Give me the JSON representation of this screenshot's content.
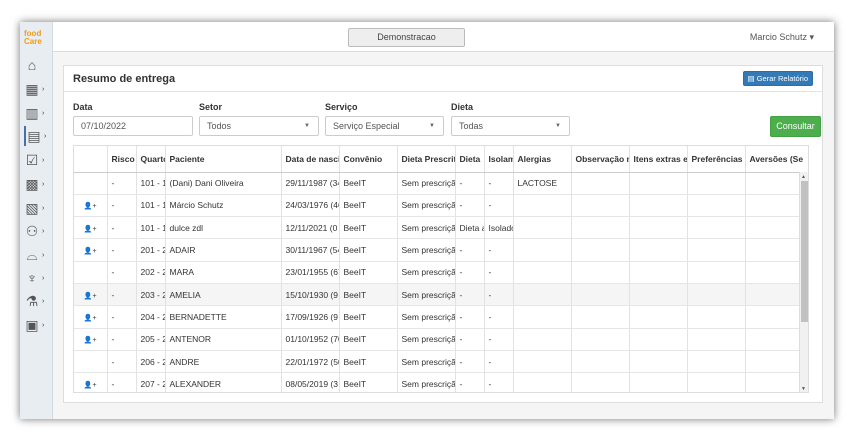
{
  "app": {
    "logo_line1": "food",
    "logo_line2": "Care"
  },
  "sidebar": {
    "items": [
      {
        "icon": "home-icon",
        "glyph": "⌂"
      },
      {
        "icon": "grid-icon",
        "glyph": "▦"
      },
      {
        "icon": "building-icon",
        "glyph": "▥"
      },
      {
        "icon": "form-icon",
        "glyph": "▤"
      },
      {
        "icon": "checklist-icon",
        "glyph": "☑"
      },
      {
        "icon": "report-building-icon",
        "glyph": "▩"
      },
      {
        "icon": "document-icon",
        "glyph": "▧"
      },
      {
        "icon": "people-icon",
        "glyph": "⚇"
      },
      {
        "icon": "food-tray-icon",
        "glyph": "⌓"
      },
      {
        "icon": "dietitian-icon",
        "glyph": "♆"
      },
      {
        "icon": "flask-icon",
        "glyph": "⚗"
      },
      {
        "icon": "settings-panel-icon",
        "glyph": "▣"
      }
    ]
  },
  "topbar": {
    "center_button": "Demonstracao",
    "user_name": "Marcio Schutz"
  },
  "panel": {
    "title": "Resumo de entrega",
    "report_button": "Gerar Relatório",
    "filters": {
      "data_label": "Data",
      "data_value": "07/10/2022",
      "setor_label": "Setor",
      "setor_value": "Todos",
      "servico_label": "Serviço",
      "servico_value": "Serviço Especial",
      "dieta_label": "Dieta",
      "dieta_value": "Todas"
    },
    "consult_button": "Consultar"
  },
  "table": {
    "headers": [
      "",
      "Risco",
      "Quarto",
      "Paciente",
      "Data de nascimento",
      "Convênio",
      "Dieta Prescrita",
      "Dieta",
      "Isolamento",
      "Alergias",
      "Observação nutricional",
      "Itens extras e",
      "Preferências",
      "Aversões (Se"
    ],
    "rows": [
      {
        "icon": "",
        "risco": "-",
        "quarto": "101 - 1",
        "paciente": "(Dani) Dani Oliveira",
        "nasc": "29/11/1987 (34",
        "convenio": "BeeIT",
        "dieta_presc": "Sem prescrição",
        "dieta": "-",
        "isol": "-",
        "alergias": "LACTOSE",
        "obs": "",
        "extras": "",
        "pref": "",
        "avers": ""
      },
      {
        "icon": "add-user",
        "risco": "-",
        "quarto": "101 - 1",
        "paciente": "Márcio Schutz",
        "nasc": "24/03/1976 (46",
        "convenio": "BeeIT",
        "dieta_presc": "Sem prescrição",
        "dieta": "-",
        "isol": "-",
        "alergias": "",
        "obs": "",
        "extras": "",
        "pref": "",
        "avers": ""
      },
      {
        "icon": "add-user",
        "risco": "-",
        "quarto": "101 - 1",
        "paciente": "dulce zdl",
        "nasc": "12/11/2021 (0",
        "convenio": "BeeIT",
        "dieta_presc": "Sem prescrição",
        "dieta": "Dieta a",
        "isol": "Isolado",
        "alergias": "",
        "obs": "",
        "extras": "",
        "pref": "",
        "avers": ""
      },
      {
        "icon": "add-user",
        "risco": "-",
        "quarto": "201 - 2",
        "paciente": "ADAIR",
        "nasc": "30/11/1967 (54",
        "convenio": "BeeIT",
        "dieta_presc": "Sem prescrição",
        "dieta": "-",
        "isol": "-",
        "alergias": "",
        "obs": "",
        "extras": "",
        "pref": "",
        "avers": ""
      },
      {
        "icon": "",
        "risco": "-",
        "quarto": "202 - 2",
        "paciente": "MARA",
        "nasc": "23/01/1955 (67",
        "convenio": "BeeIT",
        "dieta_presc": "Sem prescrição",
        "dieta": "-",
        "isol": "-",
        "alergias": "",
        "obs": "",
        "extras": "",
        "pref": "",
        "avers": ""
      },
      {
        "icon": "add-user",
        "risco": "-",
        "quarto": "203 - 2",
        "paciente": "AMELIA",
        "nasc": "15/10/1930 (9",
        "convenio": "BeeIT",
        "dieta_presc": "Sem prescrição",
        "dieta": "-",
        "isol": "-",
        "alergias": "",
        "obs": "",
        "extras": "",
        "pref": "",
        "avers": ""
      },
      {
        "icon": "add-user",
        "risco": "-",
        "quarto": "204 - 2",
        "paciente": "BERNADETTE",
        "nasc": "17/09/1926 (9",
        "convenio": "BeeIT",
        "dieta_presc": "Sem prescrição",
        "dieta": "-",
        "isol": "-",
        "alergias": "",
        "obs": "",
        "extras": "",
        "pref": "",
        "avers": ""
      },
      {
        "icon": "add-user",
        "risco": "-",
        "quarto": "205 - 2",
        "paciente": "ANTENOR",
        "nasc": "01/10/1952 (70",
        "convenio": "BeeIT",
        "dieta_presc": "Sem prescrição",
        "dieta": "-",
        "isol": "-",
        "alergias": "",
        "obs": "",
        "extras": "",
        "pref": "",
        "avers": ""
      },
      {
        "icon": "",
        "risco": "-",
        "quarto": "206 - 2",
        "paciente": "ANDRE",
        "nasc": "22/01/1972 (50",
        "convenio": "BeeIT",
        "dieta_presc": "Sem prescrição",
        "dieta": "-",
        "isol": "-",
        "alergias": "",
        "obs": "",
        "extras": "",
        "pref": "",
        "avers": ""
      },
      {
        "icon": "add-user",
        "risco": "-",
        "quarto": "207 - 2",
        "paciente": "ALEXANDER",
        "nasc": "08/05/2019 (3",
        "convenio": "BeeIT",
        "dieta_presc": "Sem prescrição",
        "dieta": "-",
        "isol": "-",
        "alergias": "",
        "obs": "",
        "extras": "",
        "pref": "",
        "avers": ""
      }
    ]
  },
  "colors": {
    "primary": "#337ab7",
    "success": "#4cae4c",
    "logo": "#f39c12"
  }
}
